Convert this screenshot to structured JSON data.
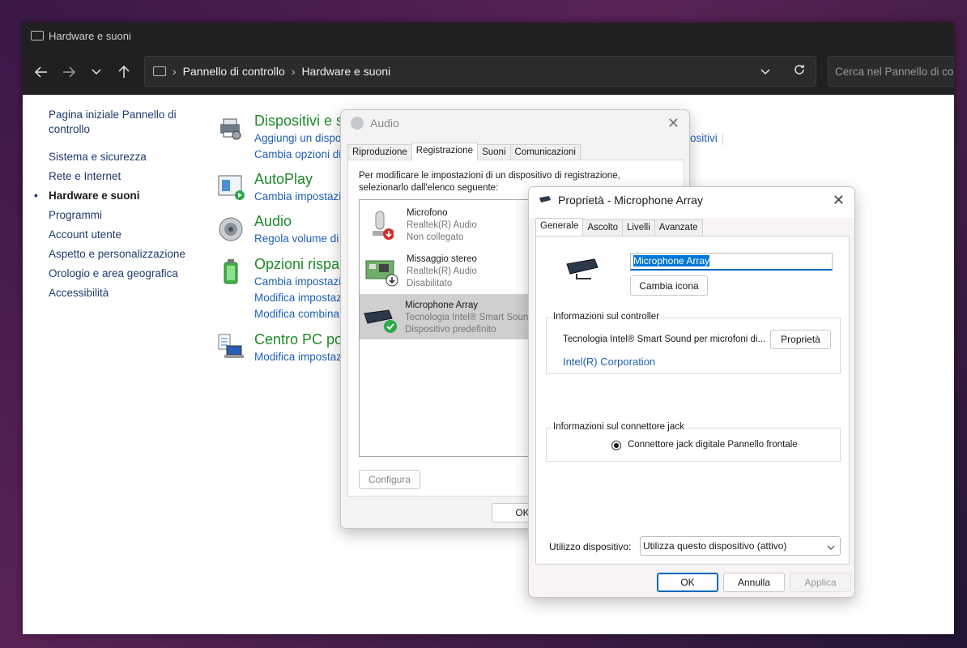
{
  "window": {
    "title": "Hardware e suoni"
  },
  "nav": {
    "back_icon": "arrow-left-icon",
    "forward_icon": "arrow-right-icon",
    "recent_icon": "chevron-down-icon",
    "up_icon": "arrow-up-icon",
    "breadcrumb": [
      "Pannello di controllo",
      "Hardware e suoni"
    ],
    "search_placeholder": "Cerca nel Pannello di controllo"
  },
  "sidebar": {
    "items": [
      {
        "label": "Pagina iniziale Pannello di controllo"
      },
      {
        "label": "Sistema e sicurezza"
      },
      {
        "label": "Rete e Internet"
      },
      {
        "label": "Hardware e suoni",
        "active": true
      },
      {
        "label": "Programmi"
      },
      {
        "label": "Account utente"
      },
      {
        "label": "Aspetto e personalizzazione"
      },
      {
        "label": "Orologio e area geografica"
      },
      {
        "label": "Accessibilità"
      }
    ]
  },
  "categories": [
    {
      "title": "Dispositivi e st",
      "links": [
        "Aggiungi un dispo",
        "Cambia opzioni di"
      ],
      "extra": "ositivi",
      "icon": "printer-icon"
    },
    {
      "title": "AutoPlay",
      "links": [
        "Cambia impostazi"
      ],
      "icon": "autoplay-icon"
    },
    {
      "title": "Audio",
      "links": [
        "Regola volume di"
      ],
      "icon": "speaker-icon"
    },
    {
      "title": "Opzioni rispar",
      "links": [
        "Cambia impostazi",
        "Modifica impostaz",
        "Modifica combina"
      ],
      "icon": "battery-icon"
    },
    {
      "title": "Centro PC por",
      "links": [
        "Modifica impostaz"
      ],
      "icon": "laptop-icon"
    }
  ],
  "audio_dialog": {
    "title": "Audio",
    "tabs": [
      "Riproduzione",
      "Registrazione",
      "Suoni",
      "Comunicazioni"
    ],
    "selected_tab": "Registrazione",
    "instructions": "Per modificare le impostazioni di un dispositivo di registrazione, selezionarlo dall'elenco seguente:",
    "devices": [
      {
        "name": "Microfono",
        "driver": "Realtek(R) Audio",
        "status": "Non collegato",
        "icon": "microphone-icon"
      },
      {
        "name": "Missaggio stereo",
        "driver": "Realtek(R) Audio",
        "status": "Disabilitato",
        "icon": "sound-card-icon"
      },
      {
        "name": "Microphone Array",
        "driver": "Tecnologia Intel® Smart Sound",
        "status": "Dispositivo predefinito",
        "icon": "webcam-icon",
        "selected": true
      }
    ],
    "configure_label": "Configura",
    "ok_label": "OK"
  },
  "props_dialog": {
    "title": "Proprietà - Microphone Array",
    "tabs": [
      "Generale",
      "Ascolto",
      "Livelli",
      "Avanzate"
    ],
    "selected_tab": "Generale",
    "device_name": "Microphone Array",
    "change_icon_label": "Cambia icona",
    "controller_group": "Informazioni sul controller",
    "controller_name": "Tecnologia Intel® Smart Sound per microfoni di...",
    "properties_label": "Proprietà",
    "manufacturer": "Intel(R) Corporation",
    "jack_group": "Informazioni sul connettore jack",
    "jack_info": "Connettore jack digitale Pannello frontale",
    "usage_label": "Utilizzo dispositivo:",
    "usage_value": "Utilizza questo dispositivo (attivo)",
    "ok_label": "OK",
    "cancel_label": "Annulla",
    "apply_label": "Applica"
  },
  "colors": {
    "link": "#1f5fb5",
    "category": "#1e8a29",
    "accent": "#0067c0"
  }
}
